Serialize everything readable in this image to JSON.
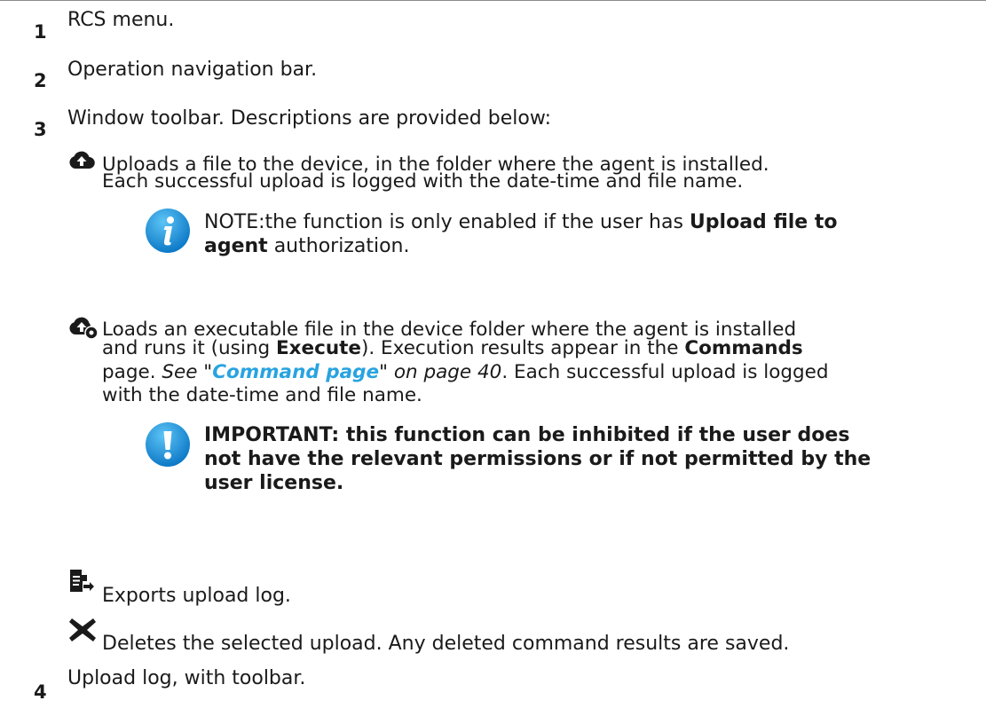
{
  "items": [
    {
      "number": "1",
      "text": "RCS menu."
    },
    {
      "number": "2",
      "text": "Operation navigation bar."
    },
    {
      "number": "3",
      "text": "Window toolbar. Descriptions are provided below:"
    },
    {
      "number": "4",
      "text": "Upload log, with toolbar."
    }
  ],
  "toolbar": {
    "upload": {
      "icon": "cloud-upload-icon",
      "line1": "Uploads a file to the device, in the folder where the agent is installed.",
      "line2": "Each successful upload is logged with the date-time and file name.",
      "note": {
        "icon": "info-icon",
        "prefix": "NOTE:the function is only enabled if the user has ",
        "bold1": "Upload file to",
        "bold2": "agent",
        "suffix": " authorization."
      }
    },
    "upload_execute": {
      "icon": "cloud-upload-gear-icon",
      "line1": "Loads an executable file in the device folder where the agent is installed",
      "line2_a": "and runs it (using ",
      "line2_b": "Execute",
      "line2_c": "). Execution results appear in the ",
      "line2_d": "Commands",
      "line3_a": "page. ",
      "line3_see": "See \"",
      "line3_link": "Command page",
      "line3_on": "\" on page 40",
      "line3_b": ". Each successful upload is logged",
      "line4": "with the date-time and file name.",
      "important": {
        "icon": "exclamation-icon",
        "line1": "IMPORTANT: this function can be inhibited if the user does",
        "line2": "not have the relevant permissions or if not permitted by the",
        "line3": "user license."
      }
    },
    "export": {
      "icon": "export-log-icon",
      "text": "Exports upload log."
    },
    "delete": {
      "icon": "delete-x-icon",
      "text": "Deletes the selected upload. Any deleted command results are saved."
    }
  },
  "colors": {
    "link": "#29a3e0",
    "icon_dark": "#1a1a1a",
    "icon_blue": "#1c8fd8"
  }
}
